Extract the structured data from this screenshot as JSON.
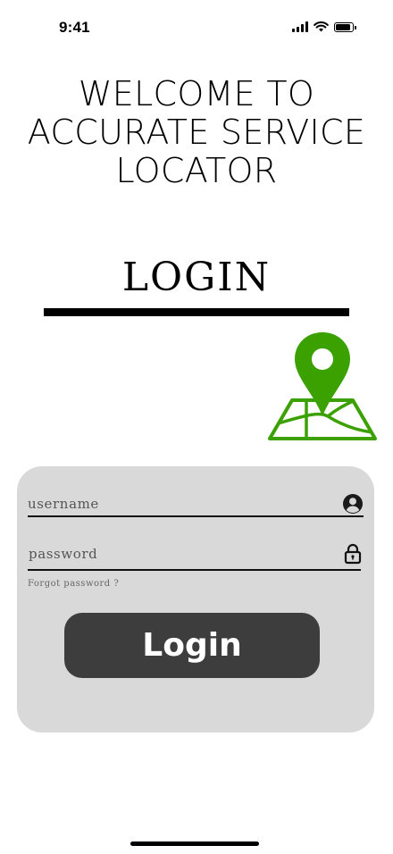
{
  "status_bar": {
    "time": "9:41"
  },
  "welcome": {
    "line1": "WELCOME TO",
    "line2": "ACCURATE SERVICE",
    "line3": "LOCATOR"
  },
  "login_title": "LOGIN",
  "map_icon": {
    "icon": "map-pin-icon",
    "color": "#3aa100"
  },
  "form": {
    "username_placeholder": "username",
    "password_placeholder": "password",
    "forgot_label": "Forgot password ?",
    "login_label": "Login"
  },
  "colors": {
    "card_bg": "#d9d9d9",
    "button_bg": "#3d3d3d",
    "accent": "#3aa100"
  }
}
